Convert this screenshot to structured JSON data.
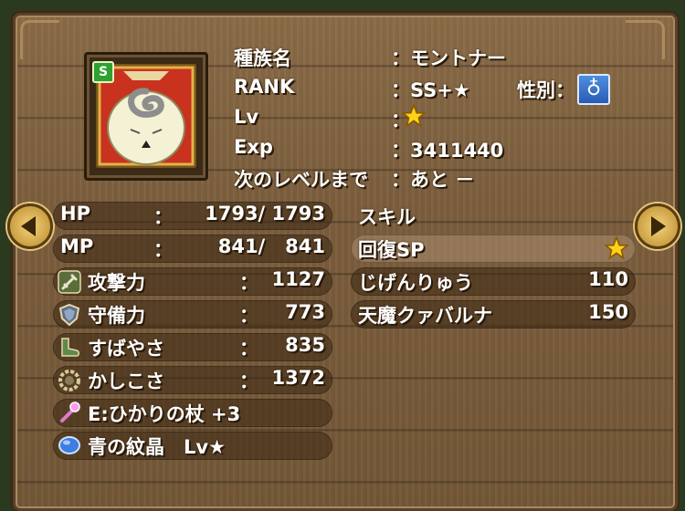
{
  "profile": {
    "species_label": "種族名",
    "species_value": "：モントナー",
    "rank_label": "RANK",
    "rank_value": "：SS+",
    "rank_star": "★",
    "gender_label": "性別：",
    "gender_symbol": "♁",
    "lv_label": "Lv",
    "lv_colon": "：",
    "exp_label": "Exp",
    "exp_value": "：3411440",
    "next_label": "次のレベルまで",
    "next_value": "：あと －",
    "badge": "S"
  },
  "stats": [
    {
      "label": "HP",
      "colon": "：",
      "value": "1793/ 1793"
    },
    {
      "label": "MP",
      "colon": "：",
      "value": "841/   841"
    },
    {
      "label": "攻撃力",
      "colon": "：",
      "value": "1127"
    },
    {
      "label": "守備力",
      "colon": "：",
      "value": "773"
    },
    {
      "label": "すばやさ",
      "colon": "：",
      "value": "835"
    },
    {
      "label": "かしこさ",
      "colon": "：",
      "value": "1372"
    }
  ],
  "equipment": {
    "weapon": "E:ひかりの杖 +3",
    "orb": "青の紋晶　Lv★"
  },
  "skills": {
    "header": "スキル",
    "items": [
      {
        "name": "回復SP",
        "value": "★"
      },
      {
        "name": "じげんりゅう",
        "value": "110"
      },
      {
        "name": "天魔クァバルナ",
        "value": "150"
      }
    ]
  },
  "colors": {
    "wood": "#7b5e3d",
    "star": "#ffd21a",
    "gender_box": "#2a5bb5"
  },
  "icons": {
    "attack": "sword-icon",
    "defense": "shield-icon",
    "speed": "boot-icon",
    "wisdom": "brain-icon",
    "weapon": "staff-icon",
    "orb": "blue-gem-icon",
    "prev": "arrow-left-icon",
    "next": "arrow-right-icon"
  }
}
